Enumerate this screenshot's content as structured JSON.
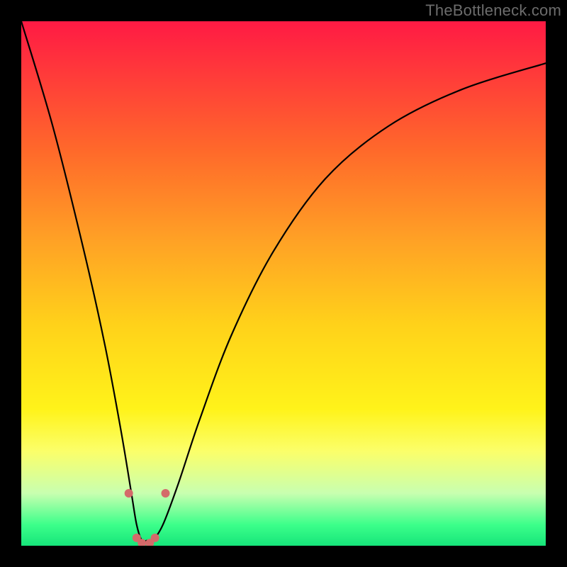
{
  "watermark": {
    "text": "TheBottleneck.com"
  },
  "chart_data": {
    "type": "line",
    "title": "",
    "xlabel": "",
    "ylabel": "",
    "xlim": [
      0,
      100
    ],
    "ylim": [
      0,
      100
    ],
    "series": [
      {
        "name": "bottleneck-curve",
        "x": [
          0,
          6,
          12,
          16,
          19,
          21,
          22,
          23,
          24,
          25,
          27,
          30,
          34,
          40,
          48,
          58,
          70,
          84,
          100
        ],
        "values": [
          100,
          80,
          56,
          38,
          22,
          10,
          4,
          1,
          1,
          1,
          4,
          12,
          24,
          40,
          56,
          70,
          80,
          87,
          92
        ]
      }
    ],
    "markers": {
      "name": "highlight-dots",
      "color": "#d46a6a",
      "x": [
        20.5,
        22.0,
        23.0,
        24.5,
        25.5,
        27.5
      ],
      "values": [
        10.0,
        1.5,
        0.5,
        0.5,
        1.5,
        10.0
      ]
    }
  }
}
